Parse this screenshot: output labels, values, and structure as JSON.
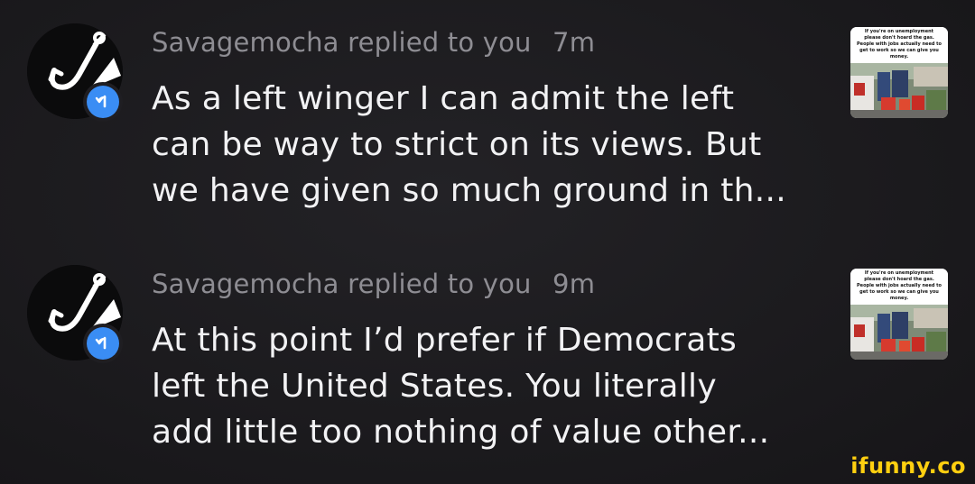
{
  "notifications": [
    {
      "username": "Savagemocha",
      "action": "replied to you",
      "time": "7m",
      "lines": [
        "As a left winger I can admit the left",
        "can be way to strict on its views. But",
        "we have given so much ground in th..."
      ],
      "thumbnail_caption": "If you're on unemployment please don't hoard the gas. People with jobs actually need to get to work so we can give you money.",
      "avatar_icon": "fishing-hook-icon",
      "badge_icon": "reply-arrow-icon"
    },
    {
      "username": "Savagemocha",
      "action": "replied to you",
      "time": "9m",
      "lines": [
        "At this point I’d prefer if Democrats",
        "left the United States. You literally",
        "add little too nothing of value other..."
      ],
      "thumbnail_caption": "If you're on unemployment please don't hoard the gas. People with jobs actually need to get to work so we can give you money.",
      "avatar_icon": "fishing-hook-icon",
      "badge_icon": "reply-arrow-icon"
    }
  ],
  "watermark": "ifunny.co",
  "colors": {
    "background": "#1b1a1d",
    "meta_text": "#8e8d93",
    "body_text": "#f2f2f4",
    "badge_blue": "#3a8df4",
    "watermark": "#ffcf10"
  }
}
